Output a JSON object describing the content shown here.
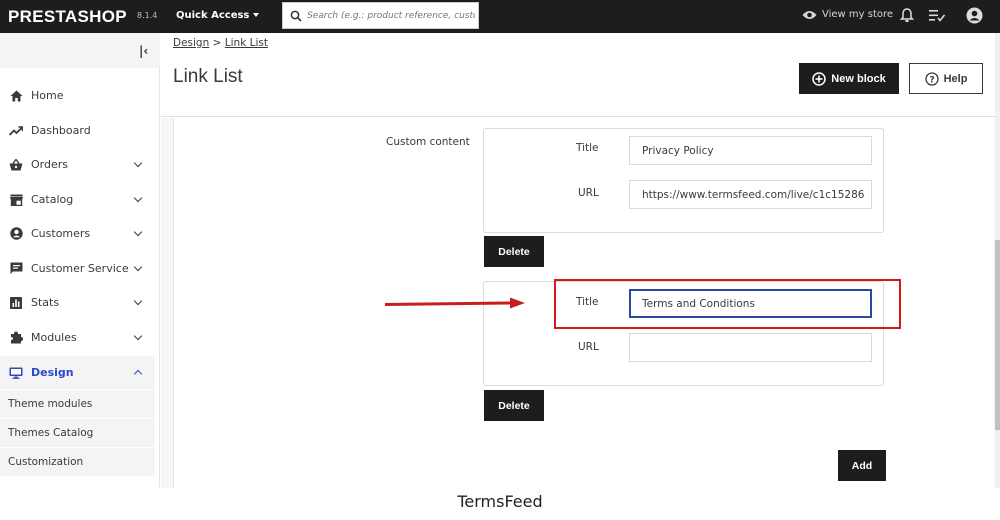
{
  "topbar": {
    "logo": "PRESTASHOP",
    "version": "8.1.4",
    "quick_access": "Quick Access",
    "search_placeholder": "Search (e.g.: product reference, custon",
    "view_store": "View my store"
  },
  "sidebar": {
    "items": [
      {
        "label": "Home",
        "icon": "home-icon"
      },
      {
        "label": "Dashboard",
        "icon": "trending-up-icon"
      },
      {
        "label": "Orders",
        "icon": "basket-icon"
      },
      {
        "label": "Catalog",
        "icon": "store-icon"
      },
      {
        "label": "Customers",
        "icon": "account-circle-icon"
      },
      {
        "label": "Customer Service",
        "icon": "chat-icon"
      },
      {
        "label": "Stats",
        "icon": "bar-chart-icon"
      },
      {
        "label": "Modules",
        "icon": "puzzle-icon"
      },
      {
        "label": "Design",
        "icon": "desktop-icon"
      }
    ],
    "subitems": [
      "Theme modules",
      "Themes Catalog",
      "Customization"
    ]
  },
  "header": {
    "breadcrumb_parent": "Design",
    "breadcrumb_sep": ">",
    "breadcrumb_current": "Link List",
    "title": "Link List",
    "new_block": "New block",
    "help": "Help"
  },
  "form": {
    "custom_content_label": "Custom content",
    "blocks": [
      {
        "title_label": "Title",
        "title_value": "Privacy Policy",
        "url_label": "URL",
        "url_value": "https://www.termsfeed.com/live/c1c15286"
      },
      {
        "title_label": "Title",
        "title_value": "Terms and Conditions",
        "url_label": "URL",
        "url_value": ""
      }
    ],
    "delete_label": "Delete",
    "add_label": "Add"
  },
  "footer": {
    "text": "TermsFeed"
  },
  "colors": {
    "topbar": "#1d1d1b",
    "active": "#2a4ac7",
    "highlight": "#d11a1a"
  }
}
